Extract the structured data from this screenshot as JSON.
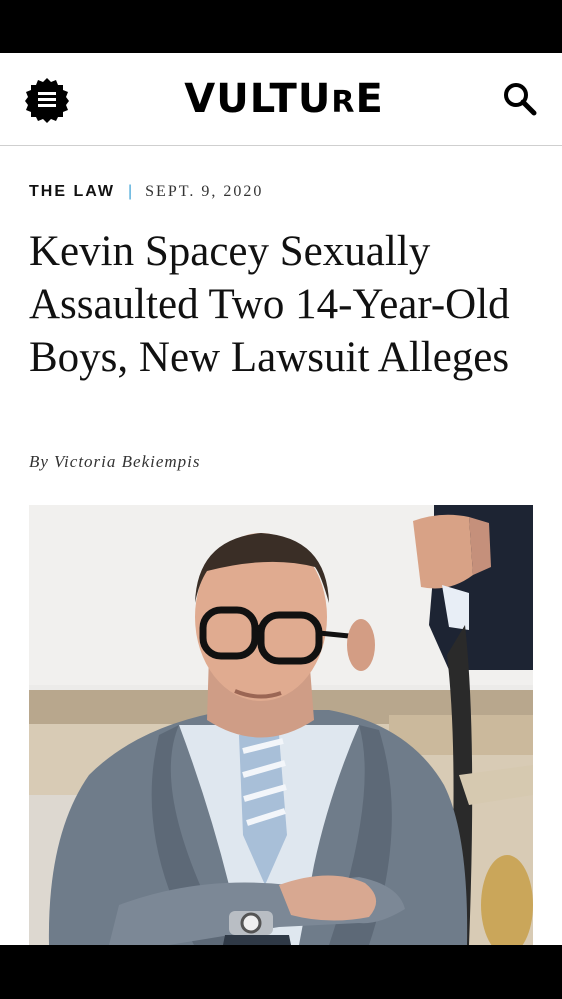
{
  "header": {
    "logo_main": "VULTU",
    "logo_small": "R",
    "logo_end": "E",
    "menu_icon": "hamburger-badge-icon",
    "search_icon": "search-icon"
  },
  "article": {
    "rubric": "THE LAW",
    "divider": "|",
    "date": "SEPT. 9, 2020",
    "headline": "Kevin Spacey Sexually Assaulted Two 14-Year-Old Boys, New Lawsuit Alleges",
    "byline_prefix": "By",
    "author": "Victoria Bekiempis"
  },
  "colors": {
    "accent": "#46a6d8",
    "text": "#111111",
    "status_bars": "#000000"
  }
}
